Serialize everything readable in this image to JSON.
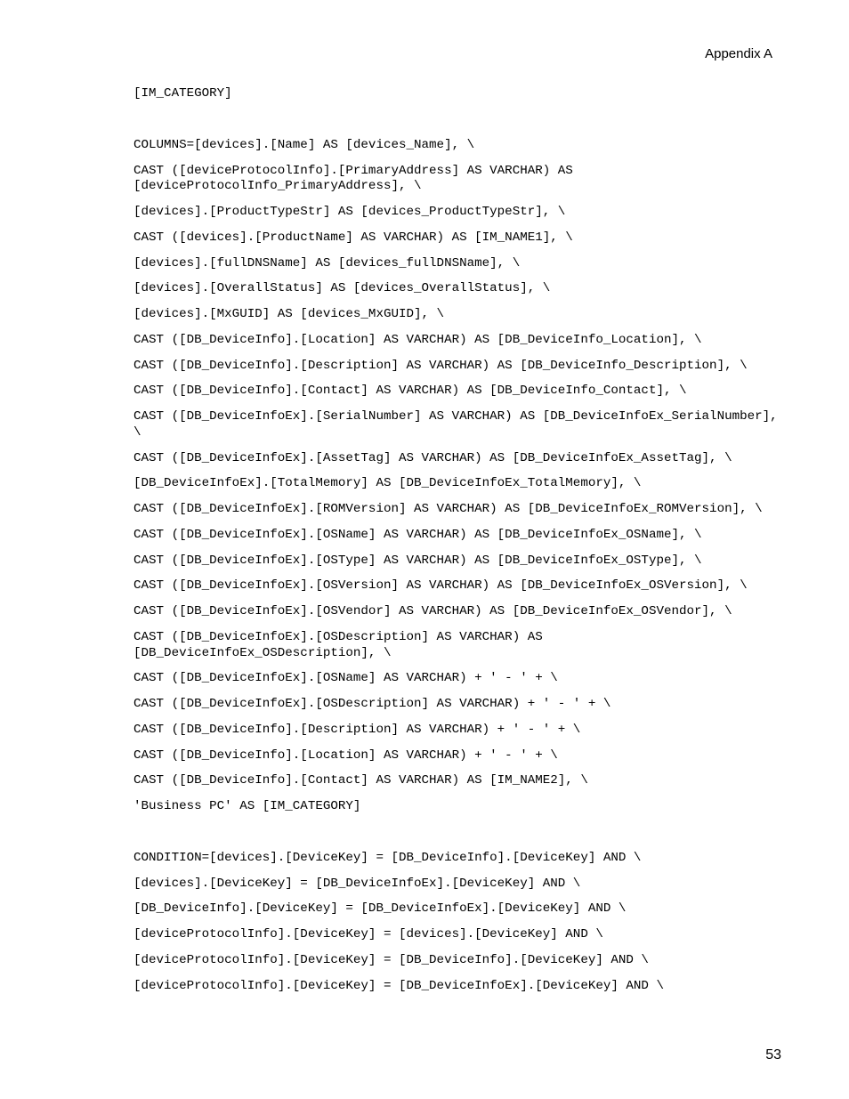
{
  "header": "Appendix A",
  "lines": [
    {
      "text": "[IM_CATEGORY]",
      "gap": true
    },
    {
      "text": "COLUMNS=[devices].[Name] AS [devices_Name], \\"
    },
    {
      "text": "CAST ([deviceProtocolInfo].[PrimaryAddress] AS VARCHAR) AS [deviceProtocolInfo_PrimaryAddress], \\"
    },
    {
      "text": "[devices].[ProductTypeStr] AS [devices_ProductTypeStr], \\"
    },
    {
      "text": "CAST ([devices].[ProductName] AS VARCHAR) AS [IM_NAME1], \\"
    },
    {
      "text": "[devices].[fullDNSName] AS [devices_fullDNSName], \\"
    },
    {
      "text": "[devices].[OverallStatus] AS [devices_OverallStatus], \\"
    },
    {
      "text": "[devices].[MxGUID] AS [devices_MxGUID], \\"
    },
    {
      "text": "CAST ([DB_DeviceInfo].[Location] AS VARCHAR) AS [DB_DeviceInfo_Location], \\"
    },
    {
      "text": "CAST ([DB_DeviceInfo].[Description] AS VARCHAR) AS [DB_DeviceInfo_Description], \\"
    },
    {
      "text": "CAST ([DB_DeviceInfo].[Contact] AS VARCHAR) AS [DB_DeviceInfo_Contact], \\"
    },
    {
      "text": "CAST ([DB_DeviceInfoEx].[SerialNumber] AS VARCHAR) AS [DB_DeviceInfoEx_SerialNumber], \\"
    },
    {
      "text": "CAST ([DB_DeviceInfoEx].[AssetTag] AS VARCHAR) AS [DB_DeviceInfoEx_AssetTag], \\"
    },
    {
      "text": "[DB_DeviceInfoEx].[TotalMemory] AS [DB_DeviceInfoEx_TotalMemory], \\"
    },
    {
      "text": "CAST ([DB_DeviceInfoEx].[ROMVersion] AS VARCHAR) AS [DB_DeviceInfoEx_ROMVersion], \\"
    },
    {
      "text": "CAST ([DB_DeviceInfoEx].[OSName] AS VARCHAR) AS [DB_DeviceInfoEx_OSName], \\"
    },
    {
      "text": "CAST ([DB_DeviceInfoEx].[OSType] AS VARCHAR) AS [DB_DeviceInfoEx_OSType], \\"
    },
    {
      "text": "CAST ([DB_DeviceInfoEx].[OSVersion] AS VARCHAR) AS [DB_DeviceInfoEx_OSVersion], \\"
    },
    {
      "text": "CAST ([DB_DeviceInfoEx].[OSVendor] AS VARCHAR) AS [DB_DeviceInfoEx_OSVendor], \\"
    },
    {
      "text": "CAST ([DB_DeviceInfoEx].[OSDescription] AS VARCHAR) AS [DB_DeviceInfoEx_OSDescription], \\"
    },
    {
      "text": "CAST ([DB_DeviceInfoEx].[OSName] AS VARCHAR) + ' - ' + \\"
    },
    {
      "text": "CAST ([DB_DeviceInfoEx].[OSDescription] AS VARCHAR) + ' - ' + \\"
    },
    {
      "text": "CAST ([DB_DeviceInfo].[Description] AS VARCHAR) + ' - ' + \\"
    },
    {
      "text": "CAST ([DB_DeviceInfo].[Location] AS VARCHAR) + ' - ' + \\"
    },
    {
      "text": "CAST ([DB_DeviceInfo].[Contact] AS VARCHAR) AS [IM_NAME2], \\"
    },
    {
      "text": "'Business PC' AS [IM_CATEGORY]",
      "gap": true
    },
    {
      "text": "CONDITION=[devices].[DeviceKey] = [DB_DeviceInfo].[DeviceKey] AND \\"
    },
    {
      "text": "[devices].[DeviceKey] = [DB_DeviceInfoEx].[DeviceKey] AND \\"
    },
    {
      "text": "[DB_DeviceInfo].[DeviceKey] = [DB_DeviceInfoEx].[DeviceKey] AND \\"
    },
    {
      "text": "[deviceProtocolInfo].[DeviceKey] = [devices].[DeviceKey] AND \\"
    },
    {
      "text": "[deviceProtocolInfo].[DeviceKey] = [DB_DeviceInfo].[DeviceKey] AND \\"
    },
    {
      "text": "[deviceProtocolInfo].[DeviceKey] = [DB_DeviceInfoEx].[DeviceKey] AND \\"
    }
  ],
  "pageNumber": "53"
}
